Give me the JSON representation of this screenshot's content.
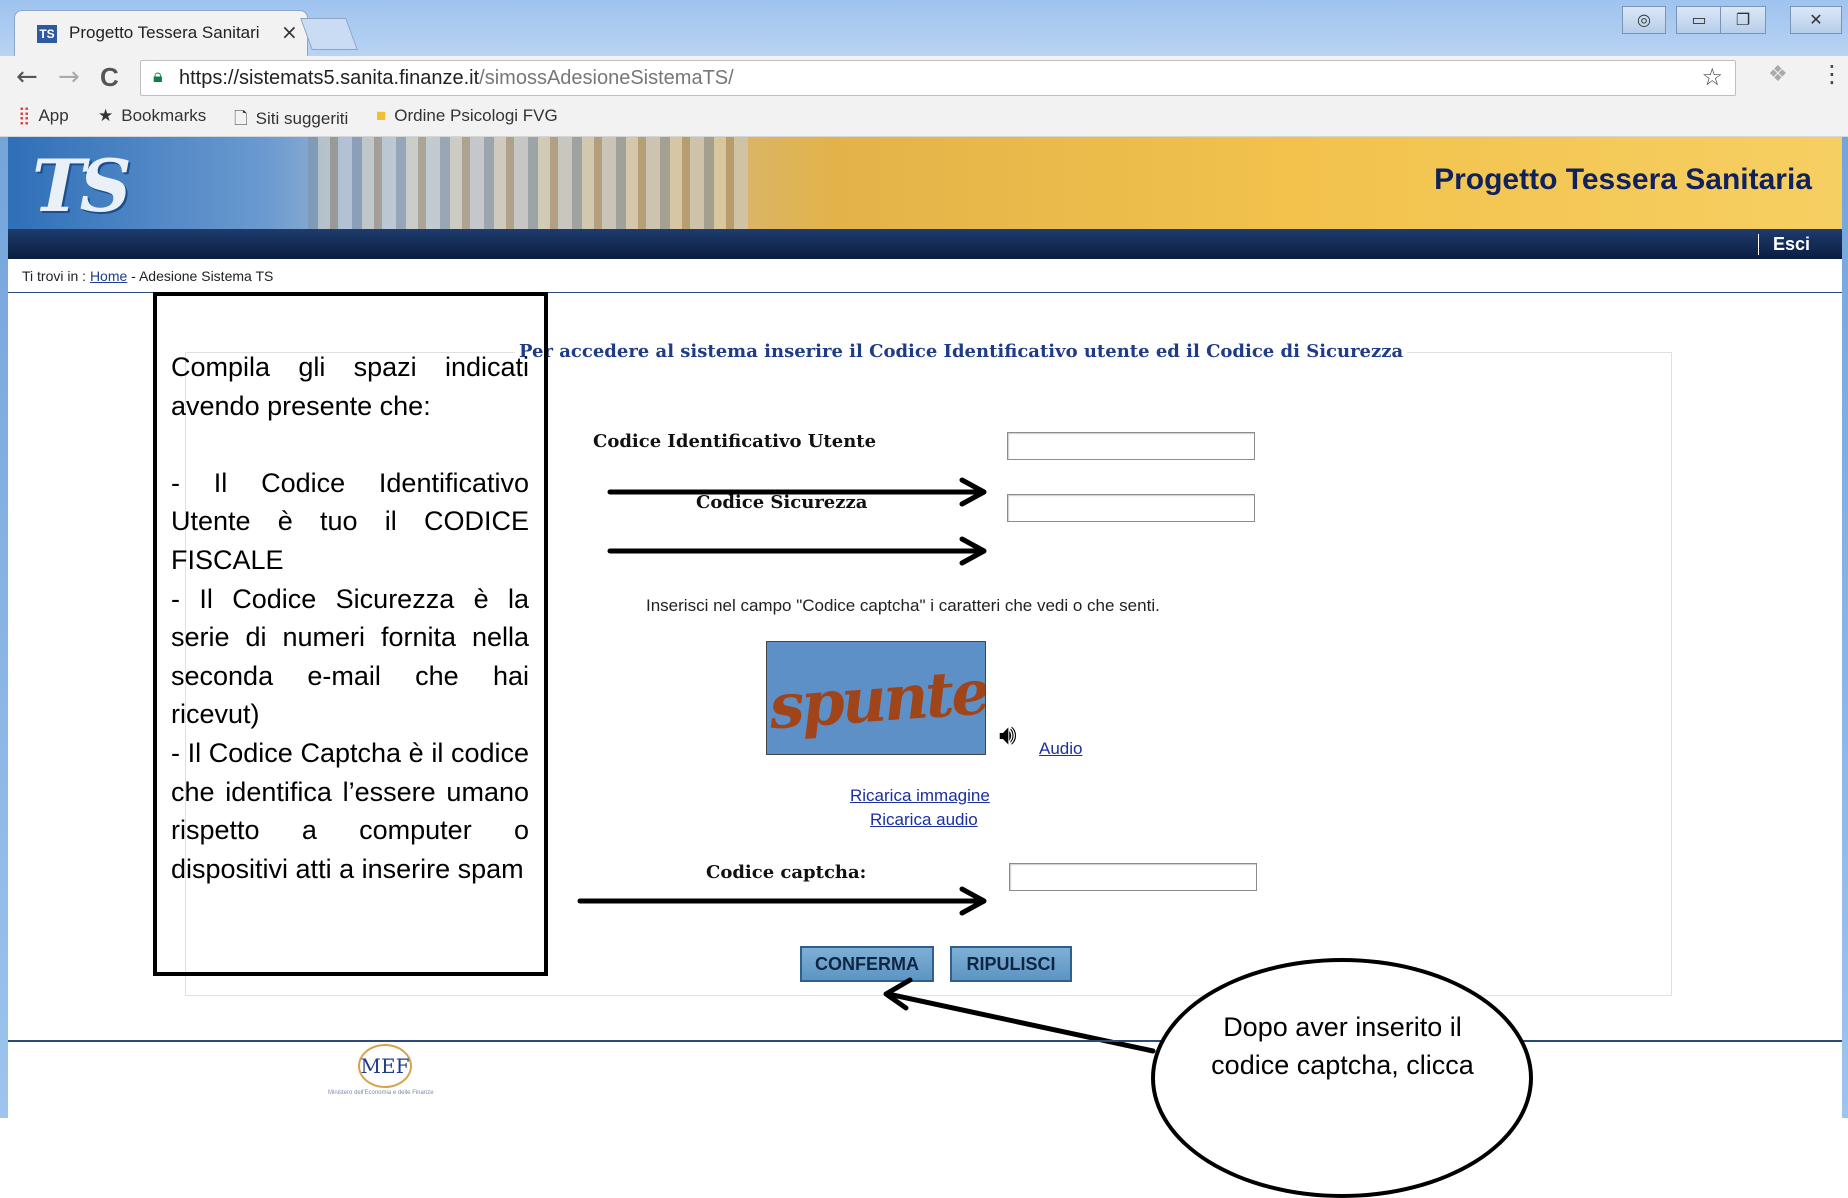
{
  "browser": {
    "tab_title": "Progetto Tessera Sanitari",
    "tab_close": "×",
    "url_host": "https://sistemats5.sanita.finanze.it",
    "url_path": "/simossAdesioneSistemaTS/",
    "back": "←",
    "forward": "→",
    "reload": "C",
    "star": "☆",
    "menu": "⋮",
    "bookmarks": [
      {
        "label": "App",
        "icon": "apps-icon"
      },
      {
        "label": "Bookmarks",
        "icon": "star-icon"
      },
      {
        "label": "Siti suggeriti",
        "icon": "page-icon"
      },
      {
        "label": "Ordine Psicologi FVG",
        "icon": "folder-icon"
      }
    ]
  },
  "site": {
    "logo": "TS",
    "title": "Progetto Tessera Sanitaria",
    "logout": "Esci",
    "breadcrumb_prefix": "Ti trovi in : ",
    "breadcrumb_home": "Home",
    "breadcrumb_rest": " - Adesione Sistema TS"
  },
  "form": {
    "legend": "Per accedere al sistema inserire il Codice Identificativo utente ed il Codice di Sicurezza",
    "user_id_label": "Codice Identificativo Utente",
    "security_code_label": "Codice Sicurezza",
    "captcha_hint": "Inserisci nel campo \"Codice captcha\" i caratteri che vedi o che senti.",
    "captcha_image_text": "spunteno",
    "audio_link": "Audio",
    "reload_image": "Ricarica immagine",
    "reload_audio": "Ricarica audio",
    "captcha_label": "Codice captcha:",
    "confirm": "CONFERMA",
    "reset": "RIPULISCI"
  },
  "annotation": {
    "intro": "Compila gli spazi indicati avendo presente che:",
    "point1": "- Il Codice Identificativo Utente è tuo il CODICE FISCALE",
    "point2": "- Il Codice Sicurezza è la serie di numeri fornita nella seconda e-mail che hai ricevut)",
    "point3": "- Il Codice Captcha è il codice che identifica l’essere umano rispetto a computer o dispositivi atti a inserire spam",
    "bubble": "Dopo aver inserito il codice captcha, clicca"
  },
  "footer": {
    "logo": "MEF",
    "caption": "Ministero dell'Economia e delle Finanze"
  },
  "colors": {
    "frame": "#9cc4ee",
    "navbar": "#0b1d40",
    "site_title": "#10215c",
    "button": "#6fa3cc"
  }
}
